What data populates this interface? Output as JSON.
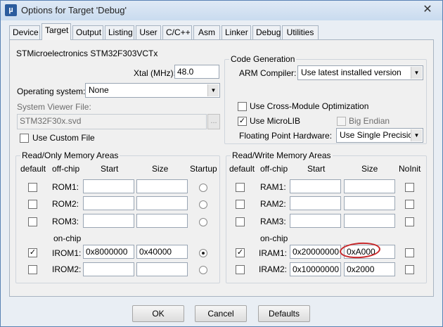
{
  "window": {
    "title": "Options for Target 'Debug'",
    "app_icon": "keil-uvision-icon",
    "close_glyph": "✕"
  },
  "tabs": [
    "Device",
    "Target",
    "Output",
    "Listing",
    "User",
    "C/C++",
    "Asm",
    "Linker",
    "Debug",
    "Utilities"
  ],
  "active_tab": "Target",
  "device_name": "STMicroelectronics STM32F303VCTx",
  "xtal": {
    "label": "Xtal (MHz):",
    "value": "48.0"
  },
  "os": {
    "label": "Operating system:",
    "value": "None"
  },
  "svd": {
    "label": "System Viewer File:",
    "value": "STM32F30x.svd",
    "browse": "..."
  },
  "custom_file": {
    "label": "Use Custom File",
    "checked": false
  },
  "codegen": {
    "legend": "Code Generation",
    "arm_compiler_label": "ARM Compiler:",
    "arm_compiler_value": "Use latest installed version",
    "cross_module": {
      "label": "Use Cross-Module Optimization",
      "checked": false
    },
    "microlib": {
      "label": "Use MicroLIB",
      "checked": true
    },
    "big_endian": {
      "label": "Big Endian",
      "checked": false,
      "disabled": true
    },
    "fp_label": "Floating Point Hardware:",
    "fp_value": "Use Single Precision"
  },
  "rom": {
    "legend": "Read/Only Memory Areas",
    "col_default": "default",
    "col_offchip": "off-chip",
    "col_start": "Start",
    "col_size": "Size",
    "col_startup": "Startup",
    "on_chip_label": "on-chip",
    "rows": [
      {
        "name": "ROM1:",
        "start": "",
        "size": "",
        "default": false,
        "startup": false
      },
      {
        "name": "ROM2:",
        "start": "",
        "size": "",
        "default": false,
        "startup": false
      },
      {
        "name": "ROM3:",
        "start": "",
        "size": "",
        "default": false,
        "startup": false
      },
      {
        "name": "IROM1:",
        "start": "0x8000000",
        "size": "0x40000",
        "default": true,
        "startup": true
      },
      {
        "name": "IROM2:",
        "start": "",
        "size": "",
        "default": false,
        "startup": false
      }
    ]
  },
  "ram": {
    "legend": "Read/Write Memory Areas",
    "col_default": "default",
    "col_offchip": "off-chip",
    "col_start": "Start",
    "col_size": "Size",
    "col_noinit": "NoInit",
    "on_chip_label": "on-chip",
    "rows": [
      {
        "name": "RAM1:",
        "start": "",
        "size": "",
        "default": false,
        "noinit": false
      },
      {
        "name": "RAM2:",
        "start": "",
        "size": "",
        "default": false,
        "noinit": false
      },
      {
        "name": "RAM3:",
        "start": "",
        "size": "",
        "default": false,
        "noinit": false
      },
      {
        "name": "IRAM1:",
        "start": "0x20000000",
        "size": "0xA000",
        "default": true,
        "noinit": false
      },
      {
        "name": "IRAM2:",
        "start": "0x10000000",
        "size": "0x2000",
        "default": false,
        "noinit": false
      }
    ]
  },
  "buttons": {
    "ok": "OK",
    "cancel": "Cancel",
    "defaults": "Defaults"
  },
  "annotation_color": "#c8282a"
}
